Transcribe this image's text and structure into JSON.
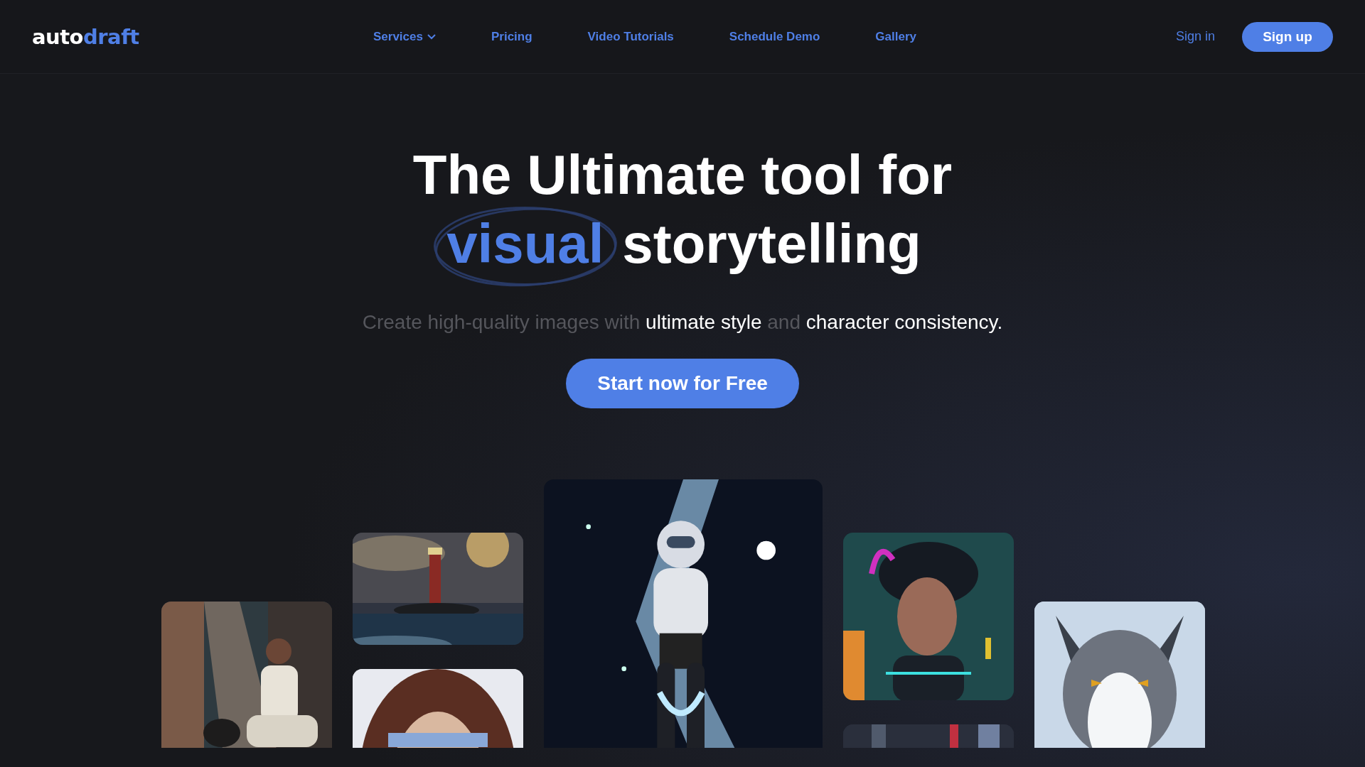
{
  "header": {
    "logo": {
      "first": "auto",
      "second": "draft"
    },
    "nav": [
      {
        "label": "Services",
        "dropdown": true
      },
      {
        "label": "Pricing",
        "dropdown": false
      },
      {
        "label": "Video Tutorials",
        "dropdown": false
      },
      {
        "label": "Schedule Demo",
        "dropdown": false
      },
      {
        "label": "Gallery",
        "dropdown": false
      }
    ],
    "sign_in": "Sign in",
    "sign_up": "Sign up"
  },
  "hero": {
    "title_line1": "The Ultimate tool for",
    "title_highlight": "visual",
    "title_rest": "storytelling",
    "subtitle": [
      {
        "text": "Create high-quality images with",
        "highlight": false
      },
      {
        "text": "ultimate style",
        "highlight": true
      },
      {
        "text": "and",
        "highlight": false
      },
      {
        "text": "character consistency.",
        "highlight": true
      }
    ],
    "cta": "Start now for Free"
  }
}
